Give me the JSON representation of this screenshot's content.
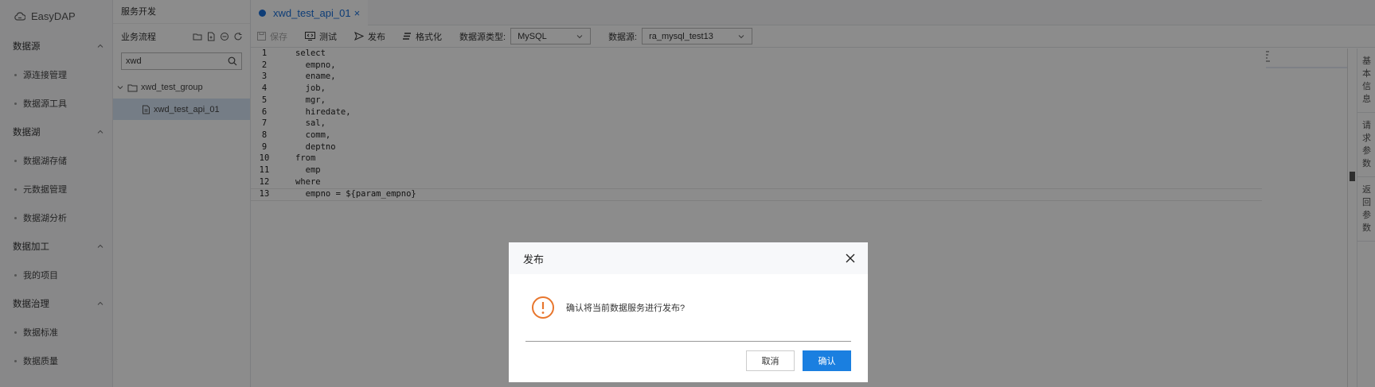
{
  "app": {
    "name": "EasyDAP"
  },
  "nav": {
    "groups": [
      {
        "label": "数据源",
        "items": [
          "源连接管理",
          "数据源工具"
        ]
      },
      {
        "label": "数据湖",
        "items": [
          "数据湖存储",
          "元数据管理",
          "数据湖分析"
        ]
      },
      {
        "label": "数据加工",
        "items": [
          "我的项目"
        ]
      },
      {
        "label": "数据治理",
        "items": [
          "数据标准",
          "数据质量"
        ]
      }
    ]
  },
  "tree": {
    "section_title": "服务开发",
    "header_label": "业务流程",
    "search_value": "xwd",
    "group_name": "xwd_test_group",
    "leaf_name": "xwd_test_api_01"
  },
  "tab": {
    "label": "xwd_test_api_01",
    "close": "×"
  },
  "toolbar": {
    "save": "保存",
    "test": "测试",
    "publish": "发布",
    "format": "格式化",
    "ds_type_label": "数据源类型:",
    "ds_type_value": "MySQL",
    "ds_label": "数据源:",
    "ds_value": "ra_mysql_test13"
  },
  "editor": {
    "lines": [
      {
        "n": "1",
        "code": "select"
      },
      {
        "n": "2",
        "code": "  empno,"
      },
      {
        "n": "3",
        "code": "  ename,"
      },
      {
        "n": "4",
        "code": "  job,"
      },
      {
        "n": "5",
        "code": "  mgr,"
      },
      {
        "n": "6",
        "code": "  hiredate,"
      },
      {
        "n": "7",
        "code": "  sal,"
      },
      {
        "n": "8",
        "code": "  comm,"
      },
      {
        "n": "9",
        "code": "  deptno"
      },
      {
        "n": "10",
        "code": "from"
      },
      {
        "n": "11",
        "code": "  emp"
      },
      {
        "n": "12",
        "code": "where"
      },
      {
        "n": "13",
        "code": "  empno = ${param_empno}"
      }
    ],
    "keywords": [
      "select",
      "from",
      "where"
    ]
  },
  "right_tabs": [
    "基本信息",
    "请求参数",
    "返回参数"
  ],
  "dialog": {
    "title": "发布",
    "message": "确认将当前数据服务进行发布?",
    "cancel": "取消",
    "confirm": "确认"
  },
  "colors": {
    "accent": "#1a7fe0",
    "warning": "#e8762d",
    "keyword": "#1f35c7"
  }
}
